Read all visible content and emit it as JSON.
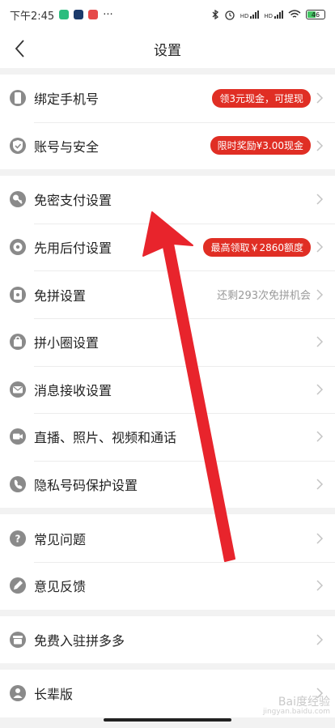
{
  "status_bar": {
    "time": "下午2:45",
    "more": "···",
    "battery": "46",
    "signal_labels": [
      "HD",
      "HD"
    ]
  },
  "header": {
    "title": "设置"
  },
  "groups": [
    [
      {
        "label": "绑定手机号",
        "icon": "phone-icon",
        "badge": "领3元现金，可提现"
      },
      {
        "label": "账号与安全",
        "icon": "shield-check-icon",
        "badge": "限时奖励¥3.00现金"
      }
    ],
    [
      {
        "label": "免密支付设置",
        "icon": "key-icon"
      },
      {
        "label": "先用后付设置",
        "icon": "gear-badge-icon",
        "badge": "最高领取￥2860额度"
      },
      {
        "label": "免拼设置",
        "icon": "ticket-icon",
        "hint": "还剩293次免拼机会"
      },
      {
        "label": "拼小圈设置",
        "icon": "bag-icon"
      },
      {
        "label": "消息接收设置",
        "icon": "mail-icon"
      },
      {
        "label": "直播、照片、视频和通话",
        "icon": "video-camera-icon"
      },
      {
        "label": "隐私号码保护设置",
        "icon": "phone-shield-icon"
      }
    ],
    [
      {
        "label": "常见问题",
        "icon": "question-icon"
      },
      {
        "label": "意见反馈",
        "icon": "pencil-icon"
      }
    ],
    [
      {
        "label": "免费入驻拼多多",
        "icon": "store-icon"
      }
    ],
    [
      {
        "label": "长辈版",
        "icon": "person-icon"
      }
    ]
  ],
  "watermark": {
    "text": "Bai度经验",
    "sub": "jingyan.baidu.com"
  },
  "colors": {
    "accent": "#e02e24",
    "arrow": "#e8242c",
    "icon": "#8a8a8a"
  }
}
